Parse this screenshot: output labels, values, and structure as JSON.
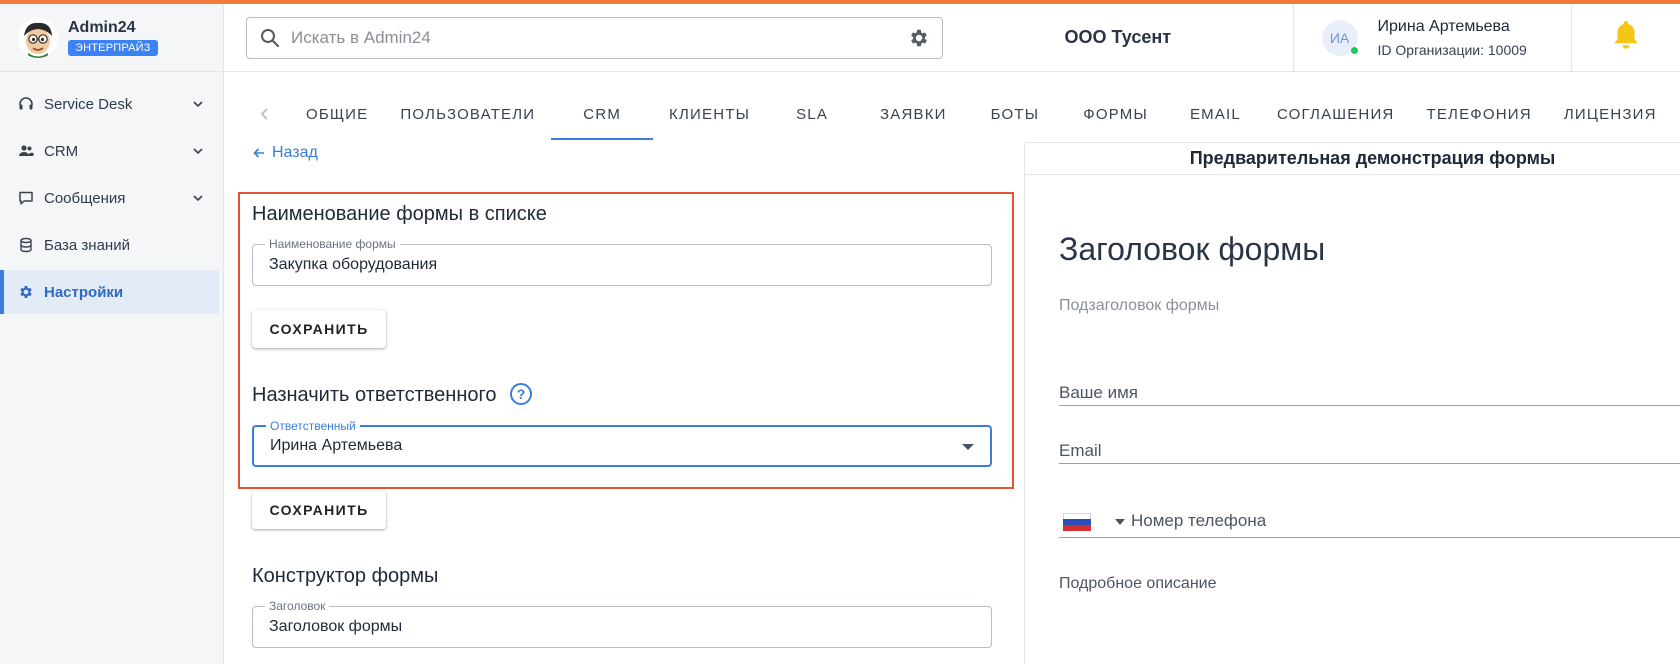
{
  "sidebar": {
    "brand_name": "Admin24",
    "brand_badge": "ЭНТЕРПРАЙЗ",
    "items": [
      {
        "label": "Service Desk",
        "icon": "headset-icon",
        "expandable": true
      },
      {
        "label": "CRM",
        "icon": "people-icon",
        "expandable": true
      },
      {
        "label": "Сообщения",
        "icon": "chat-icon",
        "expandable": true
      },
      {
        "label": "База знаний",
        "icon": "database-icon",
        "expandable": false
      },
      {
        "label": "Настройки",
        "icon": "gear-icon",
        "expandable": false,
        "active": true
      }
    ]
  },
  "header": {
    "search_placeholder": "Искать в Admin24",
    "org_name": "ООО Тусент",
    "user_initials": "ИА",
    "user_name": "Ирина Артемьева",
    "user_org_id": "ID Организации: 10009"
  },
  "tabs": [
    "ОБЩИЕ",
    "ПОЛЬЗОВАТЕЛИ",
    "CRM",
    "КЛИЕНТЫ",
    "SLA",
    "ЗАЯВКИ",
    "БОТЫ",
    "ФОРМЫ",
    "EMAIL",
    "СОГЛАШЕНИЯ",
    "ТЕЛЕФОНИЯ",
    "ЛИЦЕНЗИЯ"
  ],
  "active_tab": "CRM",
  "form": {
    "back_label": "Назад",
    "name_section_title": "Наименование формы в списке",
    "name_field_label": "Наименование формы",
    "name_field_value": "Закупка оборудования",
    "save_label": "СОХРАНИТЬ",
    "assign_section_title": "Назначить ответственного",
    "help_glyph": "?",
    "assignee_field_label": "Ответственный",
    "assignee_field_value": "Ирина Артемьева",
    "save_label_2": "СОХРАНИТЬ",
    "builder_section_title": "Конструктор формы",
    "title_field_label": "Заголовок",
    "title_field_value": "Заголовок формы"
  },
  "preview": {
    "heading": "Предварительная демонстрация формы",
    "form_title": "Заголовок формы",
    "form_subtitle": "Подзаголовок формы",
    "name_label": "Ваше имя",
    "email_label": "Email",
    "phone_label": "Номер телефона",
    "description_label": "Подробное описание"
  },
  "colors": {
    "accent": "#3b7ddd",
    "highlight_border": "#e05438",
    "top_stripe": "#f07c3c",
    "badge": "#3b82f6",
    "online": "#22c55e",
    "bell": "#f5c518"
  }
}
